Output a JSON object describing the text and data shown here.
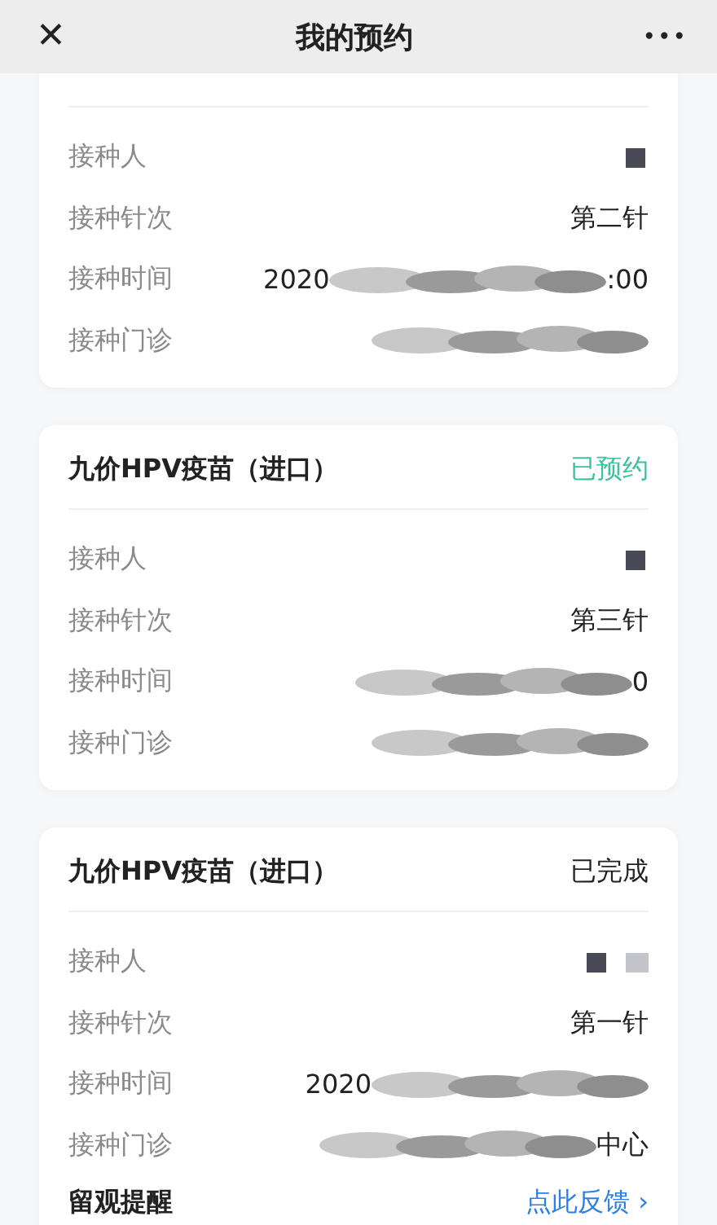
{
  "header": {
    "close": "✕",
    "title": "我的预约",
    "more": "•••"
  },
  "cards": [
    {
      "kind": "cut",
      "rows": [
        {
          "label": "接种人",
          "kind": "pixelated"
        },
        {
          "label": "接种针次",
          "kind": "text",
          "value": "第二针"
        },
        {
          "label": "接种时间",
          "kind": "blurred",
          "prefix": "2020",
          "suffix": ":00"
        },
        {
          "label": "接种门诊",
          "kind": "blurred"
        }
      ]
    },
    {
      "kind": "full",
      "title": "九价HPV疫苗（进口）",
      "status": "已预约",
      "color": "#3cc39a",
      "rows": [
        {
          "label": "接种人",
          "kind": "pixelated"
        },
        {
          "label": "接种针次",
          "kind": "text",
          "value": "第三针"
        },
        {
          "label": "接种时间",
          "kind": "blurred",
          "suffix": "0"
        },
        {
          "label": "接种门诊",
          "kind": "blurred"
        }
      ]
    },
    {
      "kind": "full",
      "title": "九价HPV疫苗（进口）",
      "status": "已完成",
      "color": "#222222",
      "rows": [
        {
          "label": "接种人",
          "kind": "pixelated_wide"
        },
        {
          "label": "接种针次",
          "kind": "text",
          "value": "第一针"
        },
        {
          "label": "接种时间",
          "kind": "blurred",
          "prefix": "2020"
        },
        {
          "label": "接种门诊",
          "kind": "blurred",
          "suffix": "中心"
        }
      ],
      "reminder": {
        "label": "留观提醒",
        "link": "点此反馈",
        "chevron": "›"
      }
    }
  ]
}
